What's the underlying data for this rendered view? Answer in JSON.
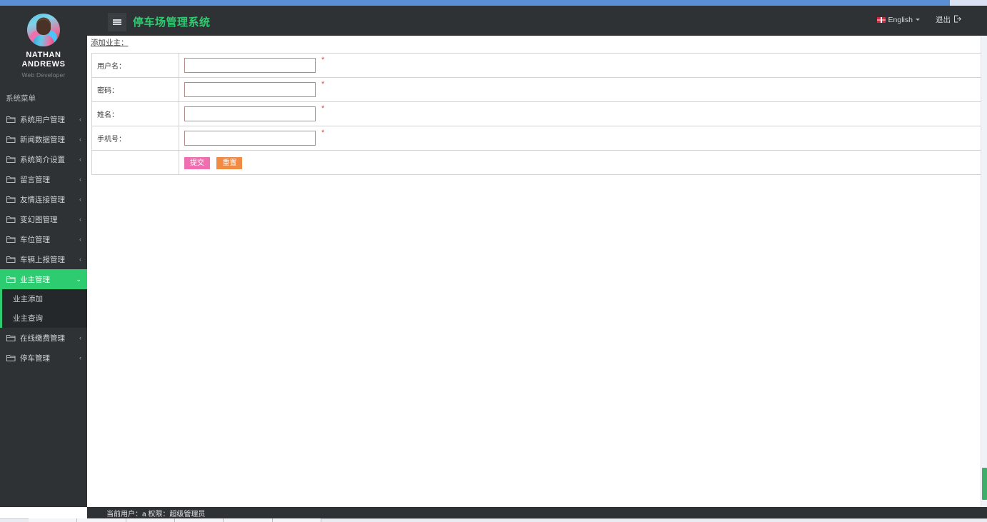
{
  "profile": {
    "name_line1": "NATHAN",
    "name_line2": "ANDREWS",
    "role": "Web Developer",
    "avatar_icon": "user-avatar-photo"
  },
  "sidebar": {
    "section_title": "系统菜单",
    "items": [
      {
        "label": "系统用户管理",
        "icon": "folder-icon",
        "arrow": "‹",
        "active": false
      },
      {
        "label": "新闻数据管理",
        "icon": "folder-icon",
        "arrow": "‹",
        "active": false
      },
      {
        "label": "系统简介设置",
        "icon": "folder-icon",
        "arrow": "‹",
        "active": false
      },
      {
        "label": "留言管理",
        "icon": "folder-icon",
        "arrow": "‹",
        "active": false
      },
      {
        "label": "友情连接管理",
        "icon": "folder-icon",
        "arrow": "‹",
        "active": false
      },
      {
        "label": "变幻图管理",
        "icon": "folder-icon",
        "arrow": "‹",
        "active": false
      },
      {
        "label": "车位管理",
        "icon": "folder-icon",
        "arrow": "‹",
        "active": false
      },
      {
        "label": "车辆上报管理",
        "icon": "folder-icon",
        "arrow": "‹",
        "active": false
      },
      {
        "label": "业主管理",
        "icon": "folder-icon",
        "arrow": "⌄",
        "active": true
      },
      {
        "label": "在线缴费管理",
        "icon": "folder-icon",
        "arrow": "‹",
        "active": false
      },
      {
        "label": "停车管理",
        "icon": "folder-icon",
        "arrow": "‹",
        "active": false
      }
    ],
    "submenu": [
      {
        "label": "业主添加"
      },
      {
        "label": "业主查询"
      }
    ],
    "active_color": "#2ecc71"
  },
  "topbar": {
    "menu_toggle_icon": "hamburger-icon",
    "brand": "停车场管理系统",
    "brand_color": "#2ecc71",
    "language": "English",
    "language_flag_icon": "uk-flag-icon",
    "language_caret_icon": "chevron-down-icon",
    "logout": "退出",
    "logout_icon": "sign-out-icon"
  },
  "content": {
    "breadcrumb": "添加业主：",
    "form": {
      "rows": [
        {
          "label": "用户名：",
          "value": "",
          "placeholder": "",
          "required_mark": "*"
        },
        {
          "label": "密码：",
          "value": "",
          "placeholder": "",
          "required_mark": "*"
        },
        {
          "label": "姓名：",
          "value": "",
          "placeholder": "",
          "required_mark": "*"
        },
        {
          "label": "手机号：",
          "value": "",
          "placeholder": "",
          "required_mark": "*"
        }
      ],
      "submit_label": "提交",
      "reset_label": "重置",
      "submit_color": "#ef6fb0",
      "reset_color": "#ef8b45"
    }
  },
  "scrollbar": {
    "thumb_color": "#3fae6a"
  },
  "footer": {
    "status": "当前用户：a 权限：超级管理员"
  }
}
